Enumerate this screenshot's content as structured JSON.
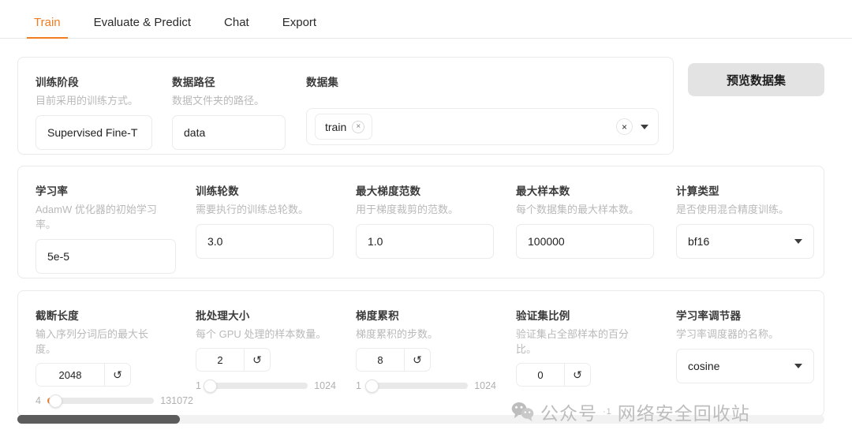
{
  "tabs": [
    {
      "label": "Train",
      "active": true
    },
    {
      "label": "Evaluate & Predict",
      "active": false
    },
    {
      "label": "Chat",
      "active": false
    },
    {
      "label": "Export",
      "active": false
    }
  ],
  "accent_color": "#f07c1f",
  "data_section": {
    "stage": {
      "label": "训练阶段",
      "hint": "目前采用的训练方式。",
      "value": "Supervised Fine-T"
    },
    "data_dir": {
      "label": "数据路径",
      "hint": "数据文件夹的路径。",
      "value": "data"
    },
    "dataset": {
      "label": "数据集",
      "tokens": [
        "train"
      ],
      "token_remove_icon": "×",
      "clear_icon": "×",
      "dropdown_icon": "caret-down"
    },
    "preview_button": "预览数据集"
  },
  "hyper_section": {
    "learning_rate": {
      "label": "学习率",
      "hint": "AdamW 优化器的初始学习率。",
      "value": "5e-5"
    },
    "epochs": {
      "label": "训练轮数",
      "hint": "需要执行的训练总轮数。",
      "value": "3.0"
    },
    "max_grad_norm": {
      "label": "最大梯度范数",
      "hint": "用于梯度裁剪的范数。",
      "value": "1.0"
    },
    "max_samples": {
      "label": "最大样本数",
      "hint": "每个数据集的最大样本数。",
      "value": "100000"
    },
    "compute_type": {
      "label": "计算类型",
      "hint": "是否使用混合精度训练。",
      "value": "bf16"
    }
  },
  "extra_section": {
    "cutoff_len": {
      "label": "截断长度",
      "hint": "输入序列分词后的最大长度。",
      "value": "2048",
      "reset_icon": "↺",
      "min": "4",
      "max": "131072",
      "fill_percent": 3
    },
    "batch_size": {
      "label": "批处理大小",
      "hint": "每个 GPU 处理的样本数量。",
      "value": "2",
      "reset_icon": "↺",
      "min": "1",
      "max": "1024",
      "fill_percent": 1
    },
    "grad_accum": {
      "label": "梯度累积",
      "hint": "梯度累积的步数。",
      "value": "8",
      "reset_icon": "↺",
      "min": "1",
      "max": "1024",
      "fill_percent": 2
    },
    "val_size": {
      "label": "验证集比例",
      "hint": "验证集占全部样本的百分比。",
      "value": "0",
      "reset_icon": "↺"
    },
    "lr_scheduler": {
      "label": "学习率调节器",
      "hint": "学习率调度器的名称。",
      "value": "cosine"
    }
  },
  "watermark": {
    "prefix": "公众号",
    "sup": "·1",
    "text": "网络安全回收站"
  }
}
